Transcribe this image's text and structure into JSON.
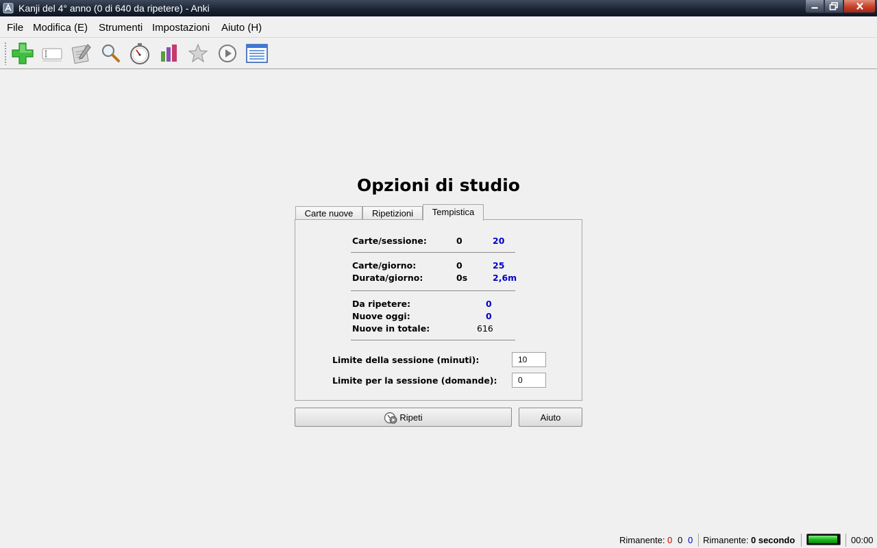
{
  "window": {
    "title": "Kanji del 4° anno (0 di 640 da ripetere) - Anki"
  },
  "menu": [
    "File",
    "Modifica (E)",
    "Strumenti",
    "Impostazioni",
    "Aiuto (H)"
  ],
  "toolbar": {
    "icons": [
      "add-icon",
      "deck-input-icon",
      "edit-notes-icon",
      "search-icon",
      "timer-icon",
      "stats-icon",
      "star-icon",
      "play-icon",
      "list-icon"
    ]
  },
  "main": {
    "title": "Opzioni di studio",
    "tabs": [
      "Carte nuove",
      "Ripetizioni",
      "Tempistica"
    ],
    "active_tab": "Tempistica",
    "stats": {
      "session_label": "Carte/sessione:",
      "session_done": "0",
      "session_goal": "20",
      "day_label": "Carte/giorno:",
      "day_done": "0",
      "day_goal": "25",
      "duration_label": "Durata/giorno:",
      "duration_done": "0s",
      "duration_goal": "2,6m",
      "due_label": "Da ripetere:",
      "due_value": "0",
      "new_today_label": "Nuove oggi:",
      "new_today_value": "0",
      "new_total_label": "Nuove in totale:",
      "new_total_value": "616"
    },
    "limits": {
      "minutes_label": "Limite della sessione (minuti):",
      "minutes_value": "10",
      "questions_label": "Limite per la sessione (domande):",
      "questions_value": "0"
    },
    "buttons": {
      "review": "Ripeti",
      "help": "Aiuto"
    }
  },
  "status": {
    "remaining_label": "Rimanente:",
    "count_red": "0",
    "count_black": "0",
    "count_blue": "0",
    "time_label": "Rimanente:",
    "time_value": "0 secondo",
    "progress_fraction": 0.96,
    "clock": "00:00"
  },
  "colors": {
    "accent_blue": "#0000c8",
    "accent_red": "#c80000",
    "progress_green": "#1fb81f"
  }
}
